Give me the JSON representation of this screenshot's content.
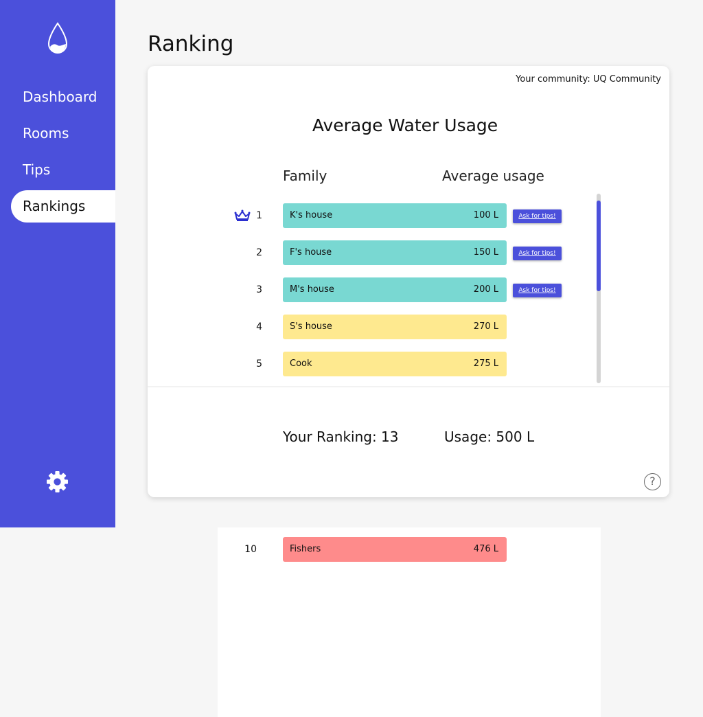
{
  "sidebar": {
    "items": [
      {
        "label": "Dashboard"
      },
      {
        "label": "Rooms"
      },
      {
        "label": "Tips"
      },
      {
        "label": "Rankings",
        "active": true
      }
    ],
    "accent_color": "#4b50db"
  },
  "page": {
    "title": "Ranking"
  },
  "card": {
    "community": "Your community: UQ Community",
    "title": "Average Water Usage",
    "col_family": "Family",
    "col_usage": "Average usage",
    "tips_label": "Ask for tips!",
    "rows": [
      {
        "rank": "1",
        "family": "K's house",
        "usage": "100 L",
        "color": "teal",
        "crown": true,
        "tips": true
      },
      {
        "rank": "2",
        "family": "F's house",
        "usage": "150 L",
        "color": "teal",
        "tips": true
      },
      {
        "rank": "3",
        "family": "M's house",
        "usage": "200 L",
        "color": "teal",
        "tips": true
      },
      {
        "rank": "4",
        "family": "S's house",
        "usage": "270 L",
        "color": "yellow"
      },
      {
        "rank": "5",
        "family": "Cook",
        "usage": "275 L",
        "color": "yellow"
      }
    ],
    "your_ranking": "Your Ranking: 13",
    "your_usage": "Usage: 500 L",
    "help": "?"
  },
  "overflow_row": {
    "rank": "10",
    "family": "Fishers",
    "usage": "476 L",
    "color": "red"
  },
  "colors": {
    "teal": "#79d8d2",
    "yellow": "#fee98f",
    "red": "#fe8b8b",
    "accent": "#4b50db"
  },
  "icons": [
    "water-drop-icon",
    "gear-icon",
    "crown-icon",
    "help-icon"
  ]
}
